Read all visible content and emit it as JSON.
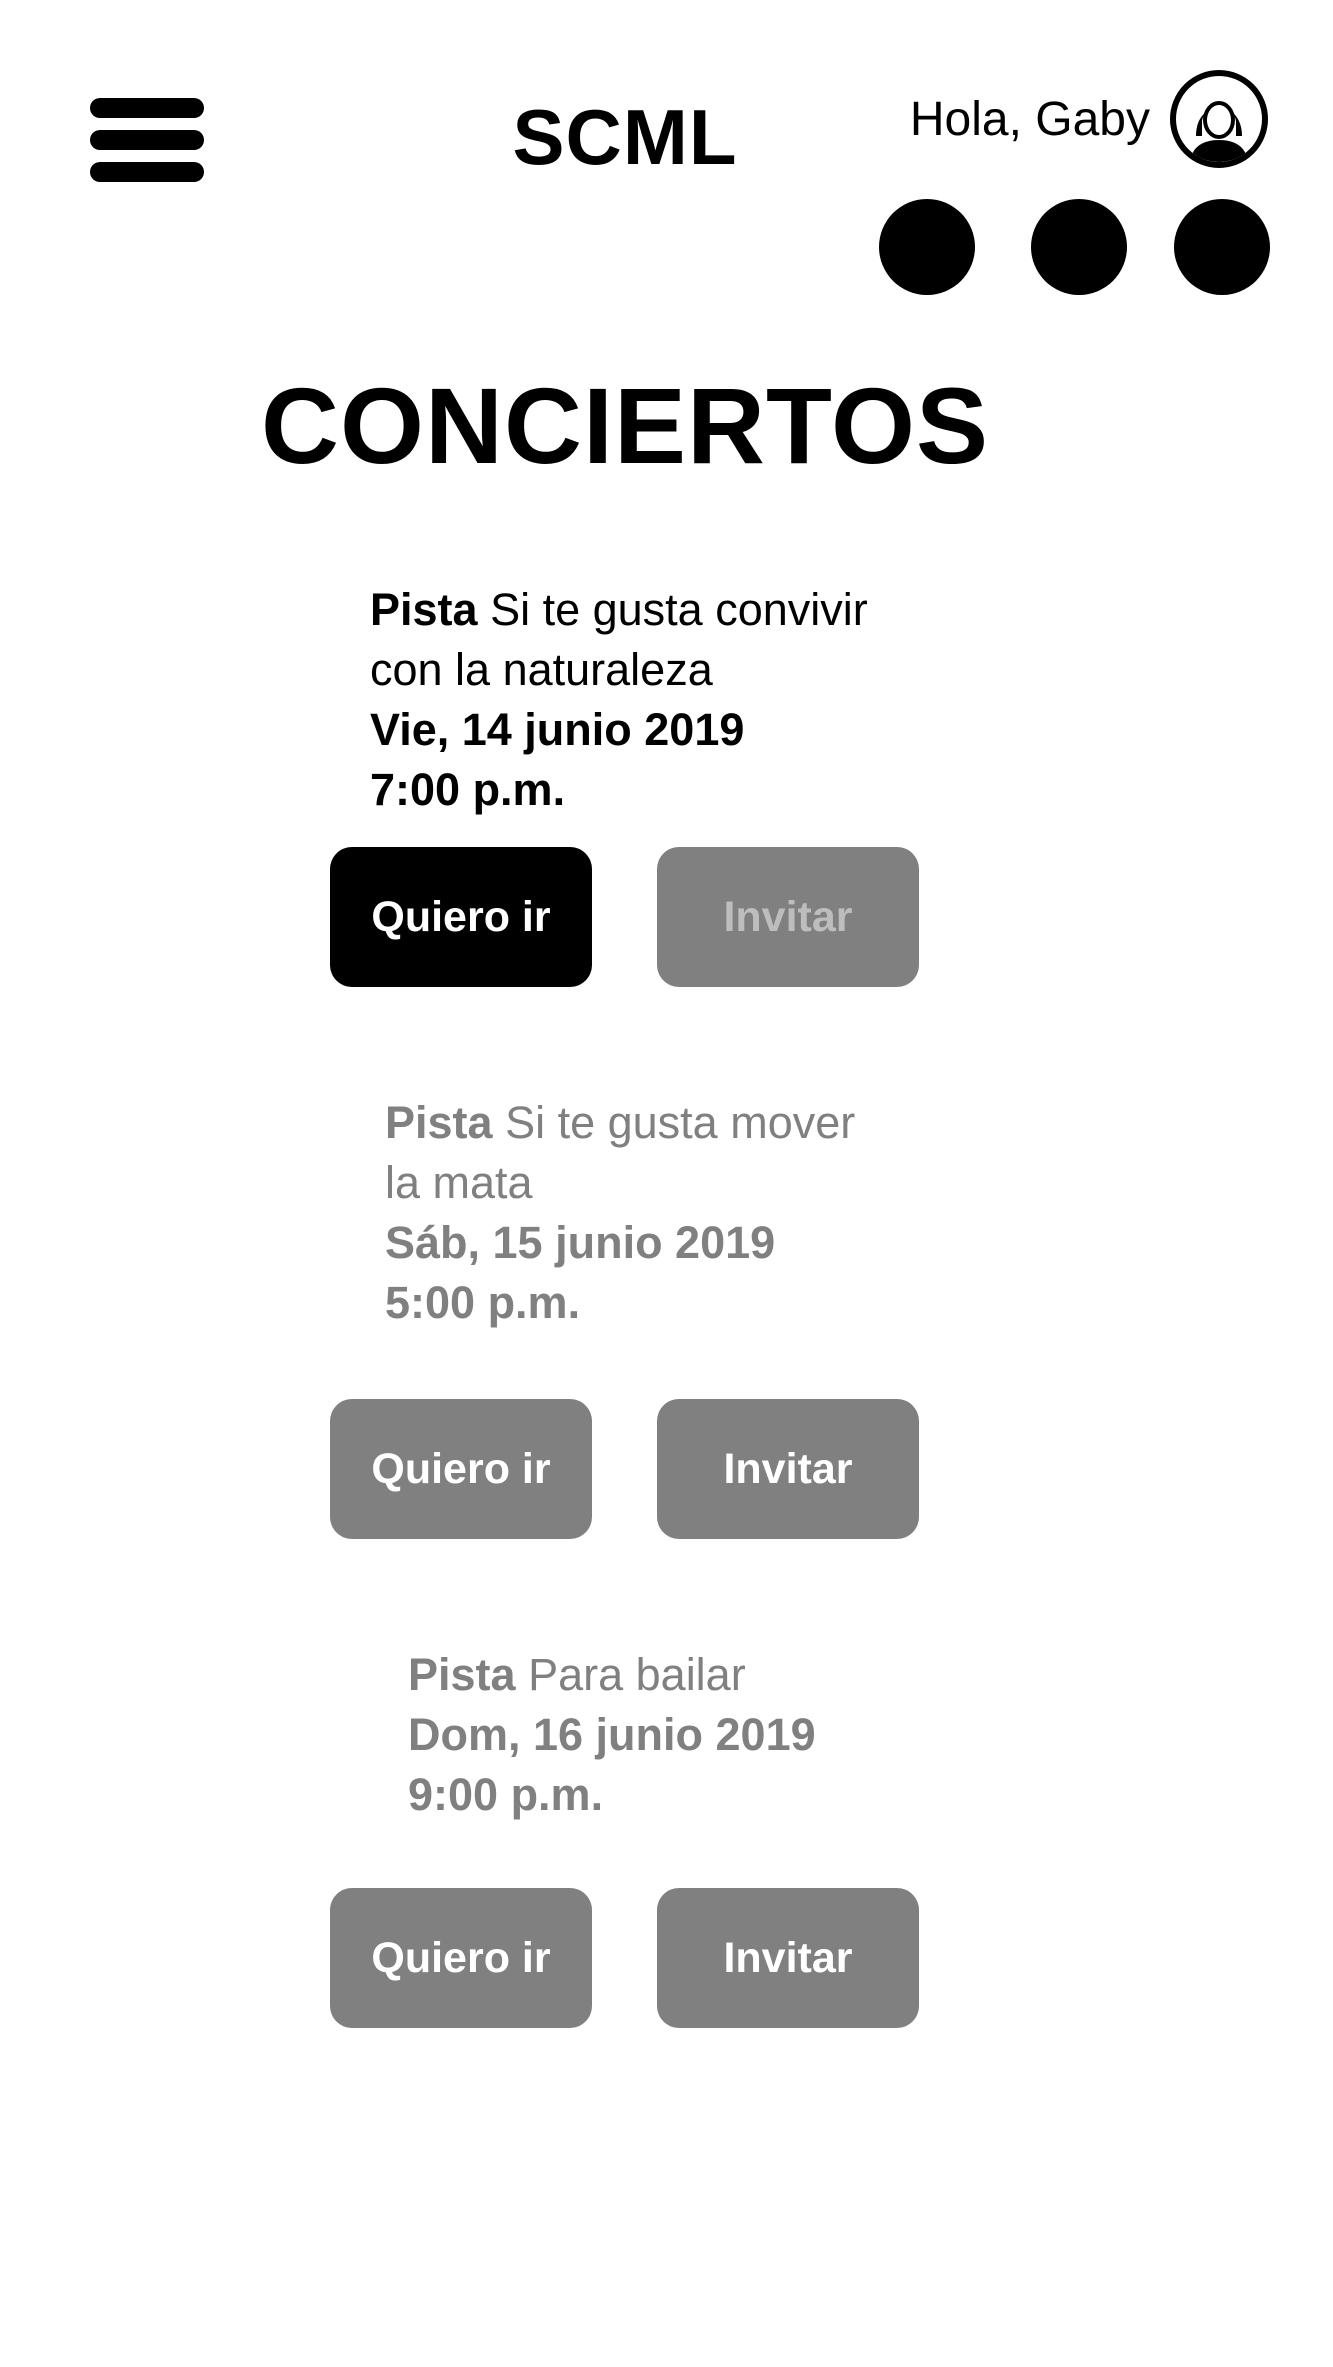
{
  "header": {
    "app_title": "SCML",
    "greeting": "Hola, Gaby"
  },
  "page": {
    "title": "CONCIERTOS"
  },
  "concerts": [
    {
      "track_label": "Pista",
      "track_line_1": "Si te gusta convivir",
      "track_line_2": "con la naturaleza",
      "date": "Vie, 14 junio 2019",
      "time": "7:00 p.m.",
      "go_label": "Quiero ir",
      "invite_label": "Invitar"
    },
    {
      "track_label": "Pista",
      "track_line_1": "Si te gusta mover",
      "track_line_2": "la mata",
      "date": "Sáb, 15 junio 2019",
      "time": "5:00 p.m.",
      "go_label": "Quiero ir",
      "invite_label": "Invitar"
    },
    {
      "track_label": "Pista",
      "track_line_1": "Para bailar",
      "date": "Dom, 16 junio 2019",
      "time": "9:00 p.m.",
      "go_label": "Quiero ir",
      "invite_label": "Invitar"
    }
  ],
  "colors": {
    "active": "#000000",
    "muted": "#808080",
    "disabled_text": "#bdbdbd"
  }
}
